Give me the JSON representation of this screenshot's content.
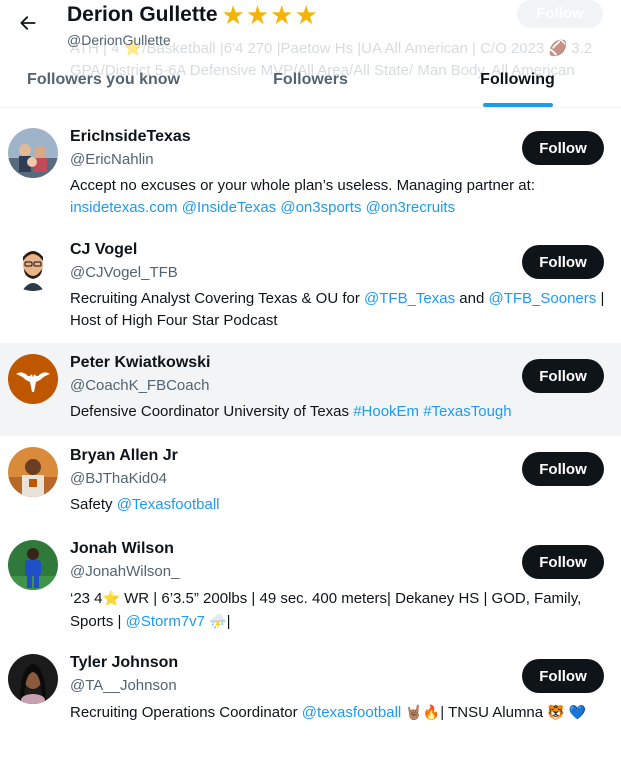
{
  "header": {
    "title": "Derion Gullette",
    "title_stars": "★★★★",
    "handle": "@DerionGullette",
    "background_bio": "ATH | 4 ⭐/Basketball |6'4 270 |Paetow Hs |UA All American | C/O 2023 🏈 3.2 GPA/District 5-6A Defensive MVP/All Area/All State/ Man Body. All American",
    "background_follow": "Follow"
  },
  "tabs": [
    {
      "label": "Followers you know"
    },
    {
      "label": "Followers"
    },
    {
      "label": "Following"
    }
  ],
  "users": [
    {
      "name": "EricInsideTexas",
      "handle": "@EricNahlin",
      "follow_label": "Follow",
      "bio": [
        {
          "t": "Accept no excuses or your whole plan’s useless. Managing partner at: "
        },
        {
          "t": "insidetexas.com",
          "link": true
        },
        {
          "t": " "
        },
        {
          "t": "@InsideTexas",
          "link": true
        },
        {
          "t": " "
        },
        {
          "t": "@on3sports",
          "link": true
        },
        {
          "t": " "
        },
        {
          "t": "@on3recruits",
          "link": true
        }
      ]
    },
    {
      "name": "CJ Vogel",
      "handle": "@CJVogel_TFB",
      "follow_label": "Follow",
      "bio": [
        {
          "t": "Recruiting Analyst Covering Texas & OU for "
        },
        {
          "t": "@TFB_Texas",
          "link": true
        },
        {
          "t": " and "
        },
        {
          "t": "@TFB_Sooners",
          "link": true
        },
        {
          "t": " | Host of High Four Star Podcast"
        }
      ]
    },
    {
      "name": "Peter Kwiatkowski",
      "handle": "@CoachK_FBCoach",
      "follow_label": "Follow",
      "bio": [
        {
          "t": "Defensive Coordinator University of Texas "
        },
        {
          "t": "#HookEm",
          "link": true
        },
        {
          "t": " "
        },
        {
          "t": "#TexasTough",
          "link": true
        }
      ]
    },
    {
      "name": "Bryan Allen Jr",
      "handle": "@BJThaKid04",
      "follow_label": "Follow",
      "bio": [
        {
          "t": "Safety "
        },
        {
          "t": "@Texasfootball",
          "link": true
        }
      ]
    },
    {
      "name": "Jonah Wilson",
      "handle": "@JonahWilson_",
      "follow_label": "Follow",
      "bio": [
        {
          "t": "‘23 4"
        },
        {
          "t": "⭐",
          "emoji": true
        },
        {
          "t": " WR | 6’3.5” 200lbs | 49 sec. 400 meters| Dekaney HS | GOD, Family, Sports | "
        },
        {
          "t": "@Storm7v7",
          "link": true
        },
        {
          "t": " "
        },
        {
          "t": "⛈️",
          "emoji": true
        },
        {
          "t": "|"
        }
      ]
    },
    {
      "name": "Tyler Johnson",
      "handle": "@TA__Johnson",
      "follow_label": "Follow",
      "bio": [
        {
          "t": "Recruiting Operations Coordinator "
        },
        {
          "t": "@texasfootball",
          "link": true
        },
        {
          "t": " "
        },
        {
          "t": "🤘🏽",
          "emoji": true
        },
        {
          "t": "🔥",
          "emoji": true
        },
        {
          "t": "| TNSU Alumna "
        },
        {
          "t": "🐯",
          "emoji": true
        },
        {
          "t": " "
        },
        {
          "t": "💙",
          "emoji": true
        }
      ]
    }
  ],
  "icons": {
    "back": "arrow-left-icon",
    "stars": "star-icon"
  },
  "colors": {
    "accent": "#1d9bf0",
    "star": "#f5b400",
    "button": "#0f1419",
    "highlight_row": "#f3f4f5"
  }
}
